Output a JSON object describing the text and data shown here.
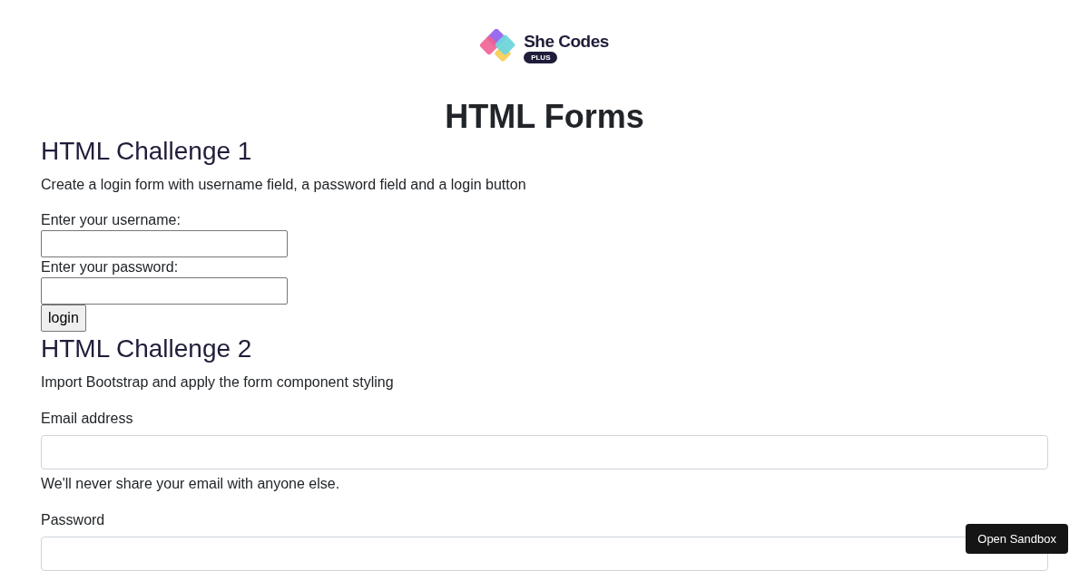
{
  "logo": {
    "name": "She Codes",
    "badge": "PLUS"
  },
  "title": "HTML Forms",
  "challenge_1": {
    "heading": "HTML Challenge 1",
    "description": "Create a login form with username field, a password field and a login button",
    "fields": [
      {
        "label": "Enter your username:"
      },
      {
        "label": "Enter your password:"
      }
    ],
    "button": "login"
  },
  "challenge_2": {
    "heading": "HTML Challenge 2",
    "description": "Import Bootstrap and apply the form component styling",
    "email": {
      "label": "Email address",
      "help": "We'll never share your email with anyone else."
    },
    "password": {
      "label": "Password"
    }
  },
  "sandbox_button": "Open Sandbox"
}
